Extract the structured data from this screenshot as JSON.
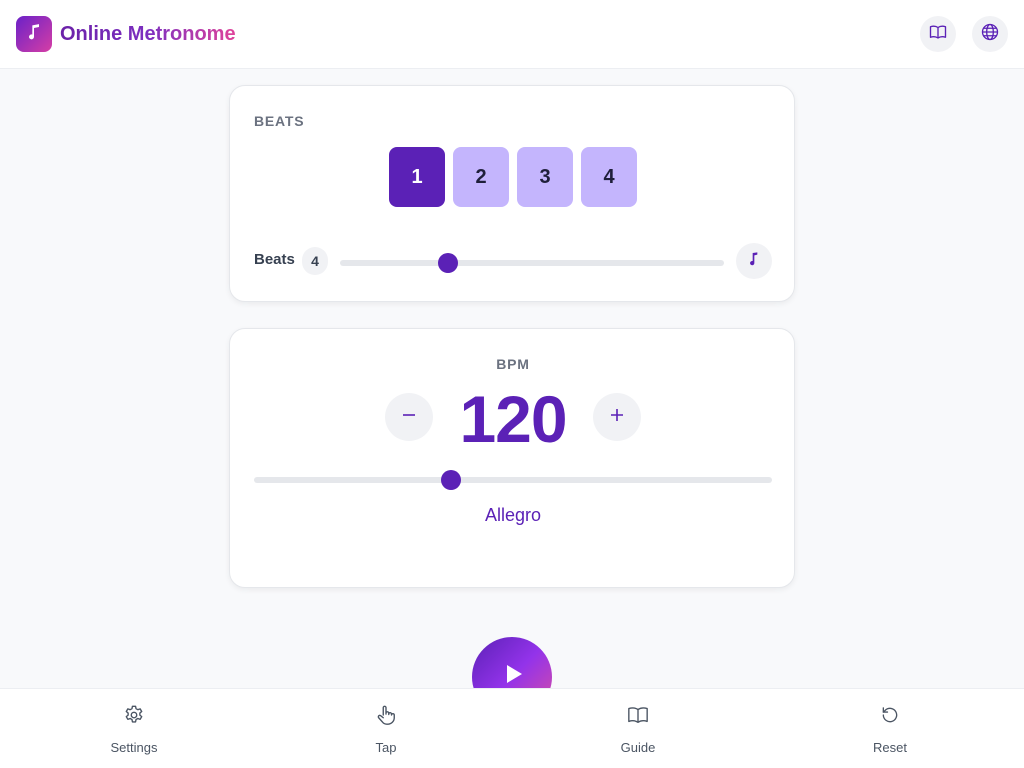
{
  "app": {
    "title": "Online Metronome",
    "logo_icon": "music-note-icon"
  },
  "header": {
    "guide_icon": "book-icon",
    "language_icon": "globe-icon"
  },
  "beats_card": {
    "label": "BEATS",
    "cells": [
      "1",
      "2",
      "3",
      "4"
    ],
    "active_index": 0,
    "control_label": "Beats",
    "count": "4",
    "slider_level_percent": 28,
    "sound_icon": "music-note-icon"
  },
  "bpm_card": {
    "label": "BPM",
    "value": "120",
    "minus_symbol": "−",
    "plus_symbol": "+",
    "slider_level_percent": 38,
    "tempo_name": "Allegro"
  },
  "play": {
    "icon": "play-icon"
  },
  "bottom_nav": [
    {
      "label": "Settings",
      "icon": "gear-icon"
    },
    {
      "label": "Tap",
      "icon": "hand-pointer-icon"
    },
    {
      "label": "Guide",
      "icon": "book-icon"
    },
    {
      "label": "Reset",
      "icon": "rotate-ccw-icon"
    }
  ],
  "colors": {
    "accent": "#5b21b6",
    "beat_inactive": "#c4b5fd",
    "gradient_start": "#6b21c8",
    "gradient_end": "#d63ea5"
  }
}
